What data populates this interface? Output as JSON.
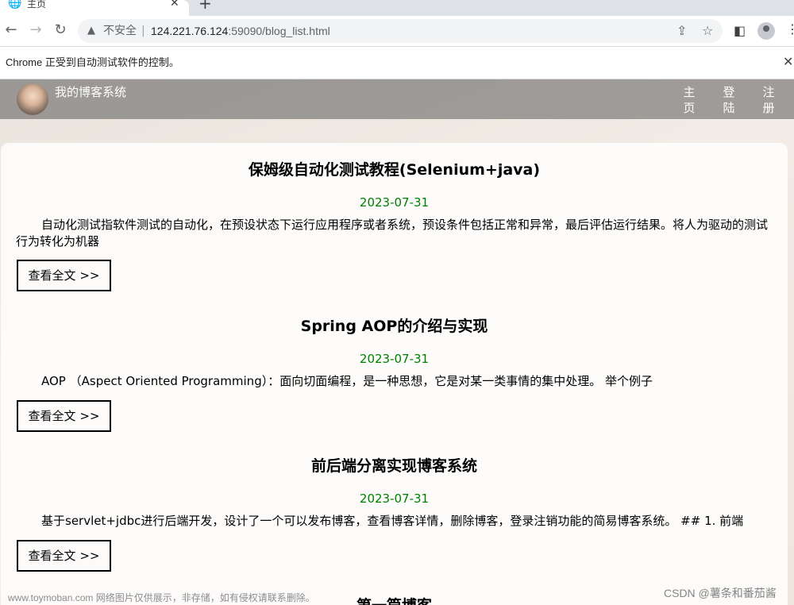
{
  "browser": {
    "tab": {
      "title": "主页",
      "favicon": "globe-icon",
      "close_glyph": "✕"
    },
    "new_tab_glyph": "+",
    "nav": {
      "back": "←",
      "forward": "→",
      "reload": "↻"
    },
    "omnibox": {
      "security_icon": "warning-triangle-icon",
      "security_label": "不安全",
      "separator": "|",
      "url_host": "124.221.76.124",
      "url_port_path": ":59090/blog_list.html"
    },
    "infobar": {
      "message": "Chrome 正受到自动测试软件的控制。",
      "close_glyph": "✕"
    }
  },
  "site": {
    "title": "我的博客系统",
    "nav_links": [
      "主页",
      "登陆",
      "注册"
    ]
  },
  "blogs": [
    {
      "title": "保姆级自动化测试教程(Selenium+java)",
      "date": "2023-07-31",
      "desc": "自动化测试指软件测试的自动化，在预设状态下运行应用程序或者系统，预设条件包括正常和异常，最后评估运行结果。将人为驱动的测试行为转化为机器",
      "button": "查看全文 >>"
    },
    {
      "title": "Spring AOP的介绍与实现",
      "date": "2023-07-31",
      "desc": "AOP （Aspect Oriented Programming）：面向切面编程，是一种思想，它是对某一类事情的集中处理。 举个例子",
      "button": "查看全文 >>"
    },
    {
      "title": "前后端分离实现博客系统",
      "date": "2023-07-31",
      "desc": "基于servlet+jdbc进行后端开发，设计了一个可以发布博客，查看博客详情，删除博客，登录注销功能的简易博客系统。 ## 1. 前端",
      "button": "查看全文 >>"
    },
    {
      "title": "第一篇博客"
    }
  ],
  "watermarks": {
    "left": "www.toymoban.com 网络图片仅供展示，非存储，如有侵权请联系删除。",
    "right": "CSDN @薯条和番茄酱"
  }
}
